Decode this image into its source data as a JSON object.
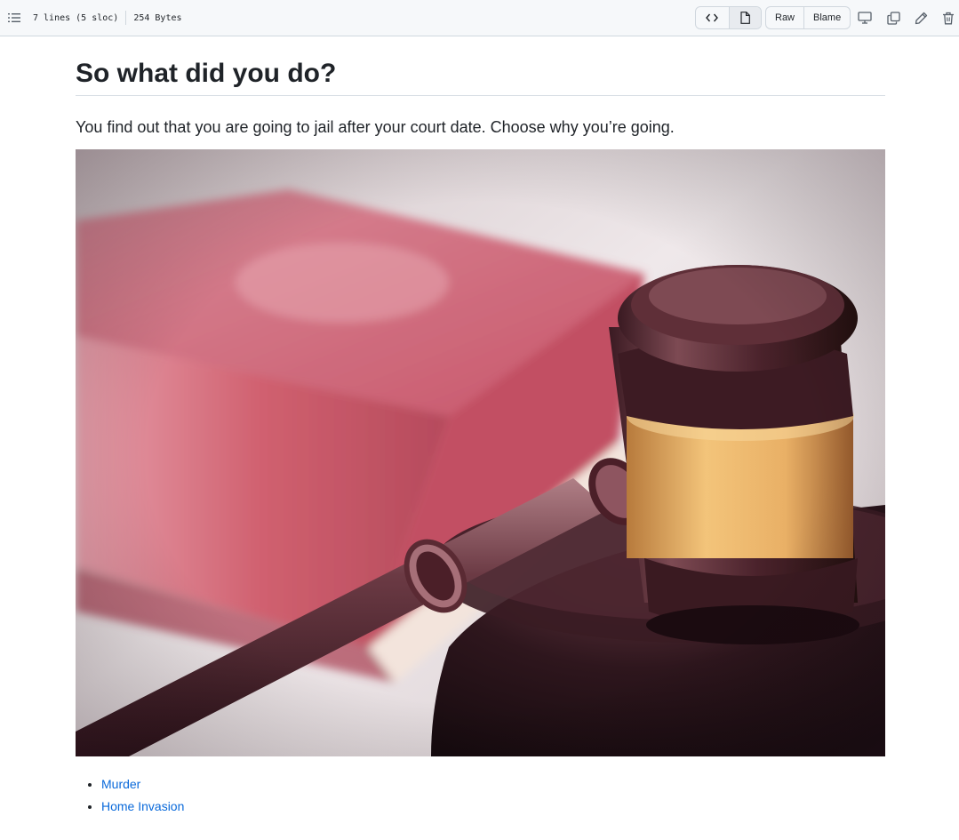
{
  "toolbar": {
    "lines_info": "7 lines (5 sloc)",
    "size_info": "254 Bytes",
    "raw_label": "Raw",
    "blame_label": "Blame",
    "icons": [
      "outline-list-icon",
      "code-icon",
      "file-icon",
      "desktop-icon",
      "copy-icon",
      "pencil-icon",
      "trash-icon"
    ]
  },
  "article": {
    "title": "So what did you do?",
    "intro": "You find out that you are going to jail after your court date. Choose why you’re going.",
    "choices": [
      {
        "label": "Murder"
      },
      {
        "label": "Home Invasion"
      }
    ]
  },
  "colors": {
    "link": "#0969da",
    "border": "#d0d7de",
    "toolbar_bg": "#f6f8fa"
  }
}
